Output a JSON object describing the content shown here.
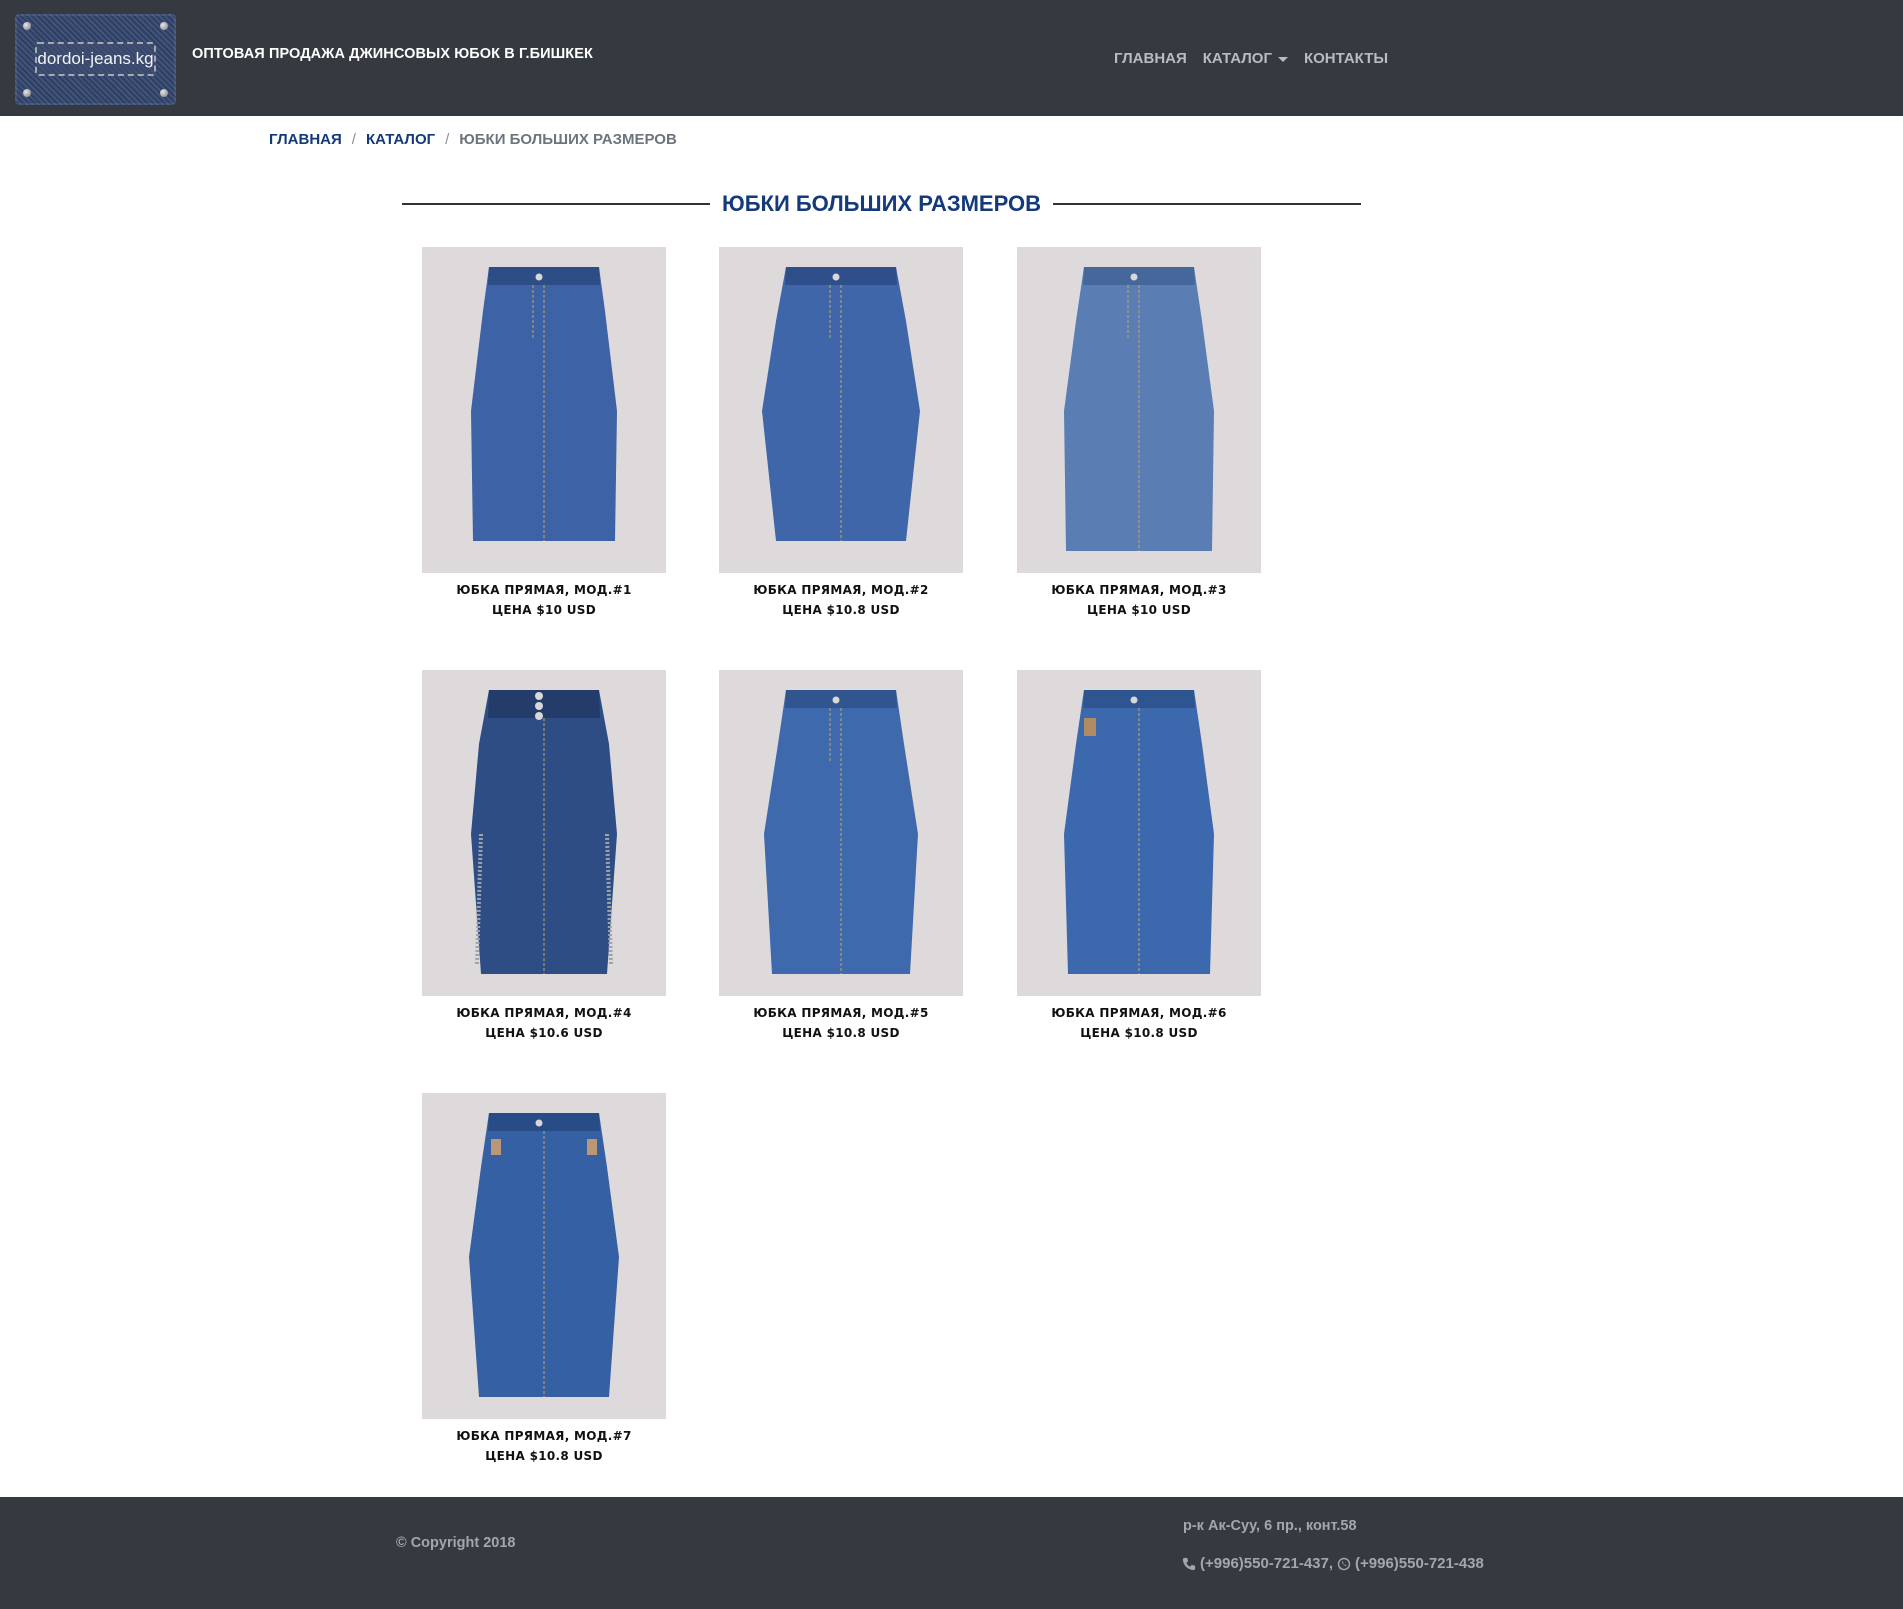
{
  "header": {
    "logo_text": "dordoi-jeans.kg",
    "site_title": "ОПТОВАЯ ПРОДАЖА ДЖИНСОВЫХ ЮБОК В Г.БИШКЕК",
    "nav": {
      "home": "ГЛАВНАЯ",
      "catalog": "КАТАЛОГ",
      "contacts": "КОНТАКТЫ"
    }
  },
  "breadcrumb": {
    "home": "ГЛАВНАЯ",
    "catalog": "КАТАЛОГ",
    "current": "ЮБКИ БОЛЬШИХ РАЗМЕРОВ",
    "separator": "/"
  },
  "section": {
    "title": "ЮБКИ БОЛЬШИХ РАЗМЕРОВ"
  },
  "products": [
    {
      "name": "ЮБКА ПРЯМАЯ, МОД.#1",
      "price": "ЦЕНА $10 USD",
      "shade": "#3d63a6"
    },
    {
      "name": "ЮБКА ПРЯМАЯ, МОД.#2",
      "price": "ЦЕНА $10.8 USD",
      "shade": "#3f66a8"
    },
    {
      "name": "ЮБКА ПРЯМАЯ, МОД.#3",
      "price": "ЦЕНА $10 USD",
      "shade": "#5a7db3"
    },
    {
      "name": "ЮБКА ПРЯМАЯ, МОД.#4",
      "price": "ЦЕНА $10.6 USD",
      "shade": "#2e4d85"
    },
    {
      "name": "ЮБКА ПРЯМАЯ, МОД.#5",
      "price": "ЦЕНА $10.8 USD",
      "shade": "#3f69ad"
    },
    {
      "name": "ЮБКА ПРЯМАЯ, МОД.#6",
      "price": "ЦЕНА $10.8 USD",
      "shade": "#3c68ad"
    },
    {
      "name": "ЮБКА ПРЯМАЯ, МОД.#7",
      "price": "ЦЕНА $10.8 USD",
      "shade": "#3560a3"
    }
  ],
  "footer": {
    "copyright": "© Copyright 2018",
    "address": "р-к Ак-Суу, 6 пр., конт.58",
    "phone1": "(+996)550-721-437,",
    "phone2": "(+996)550-721-438",
    "phone_icon": "phone-icon",
    "whatsapp_icon": "whatsapp-icon"
  },
  "colors": {
    "header_bg": "#343a40",
    "accent": "#143a7a",
    "nav_text": "#b8bcc0",
    "card_bg": "#dedadb"
  }
}
